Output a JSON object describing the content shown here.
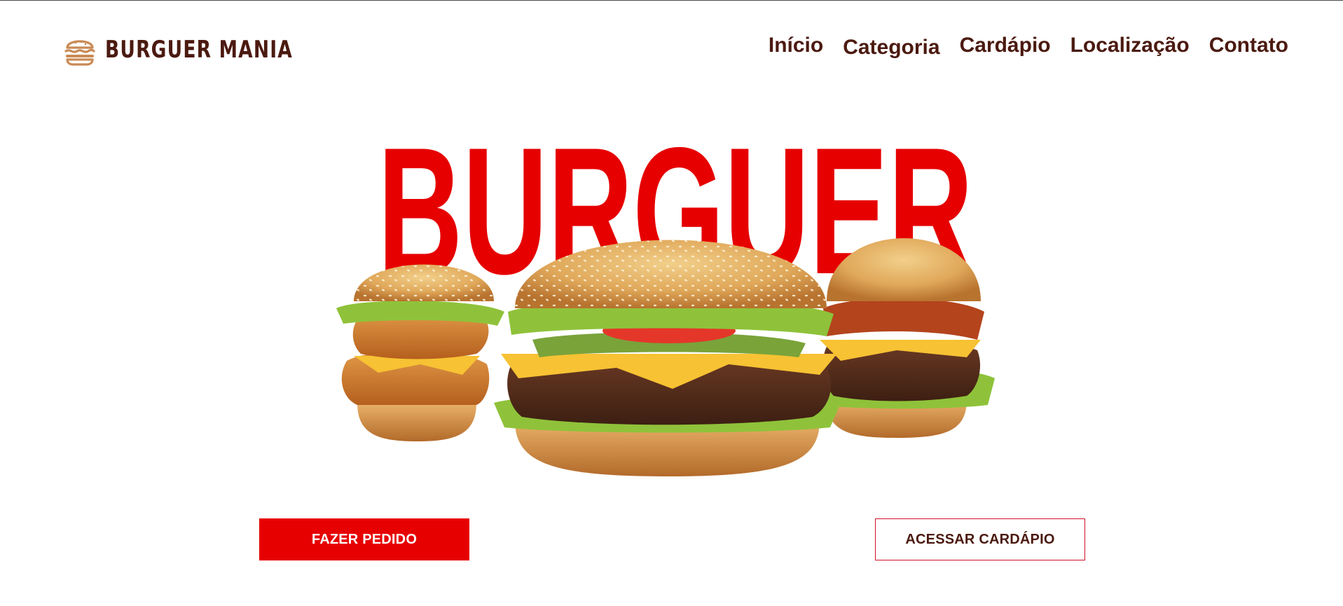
{
  "brand": {
    "name": "BURGUER MANIA",
    "logo_icon": "burger-icon",
    "text_color": "#4b1a10",
    "icon_color": "#c98a55"
  },
  "nav": {
    "items": [
      {
        "label": "Início"
      },
      {
        "label": "Categoria"
      },
      {
        "label": "Cardápio"
      },
      {
        "label": "Localização"
      },
      {
        "label": "Contato"
      }
    ]
  },
  "hero": {
    "title": "BURGUER",
    "title_color": "#e60000",
    "image": "three-burgers-photo"
  },
  "actions": {
    "primary_label": "FAZER PEDIDO",
    "secondary_label": "ACESSAR CARDÁPIO",
    "accent": "#e60000"
  }
}
